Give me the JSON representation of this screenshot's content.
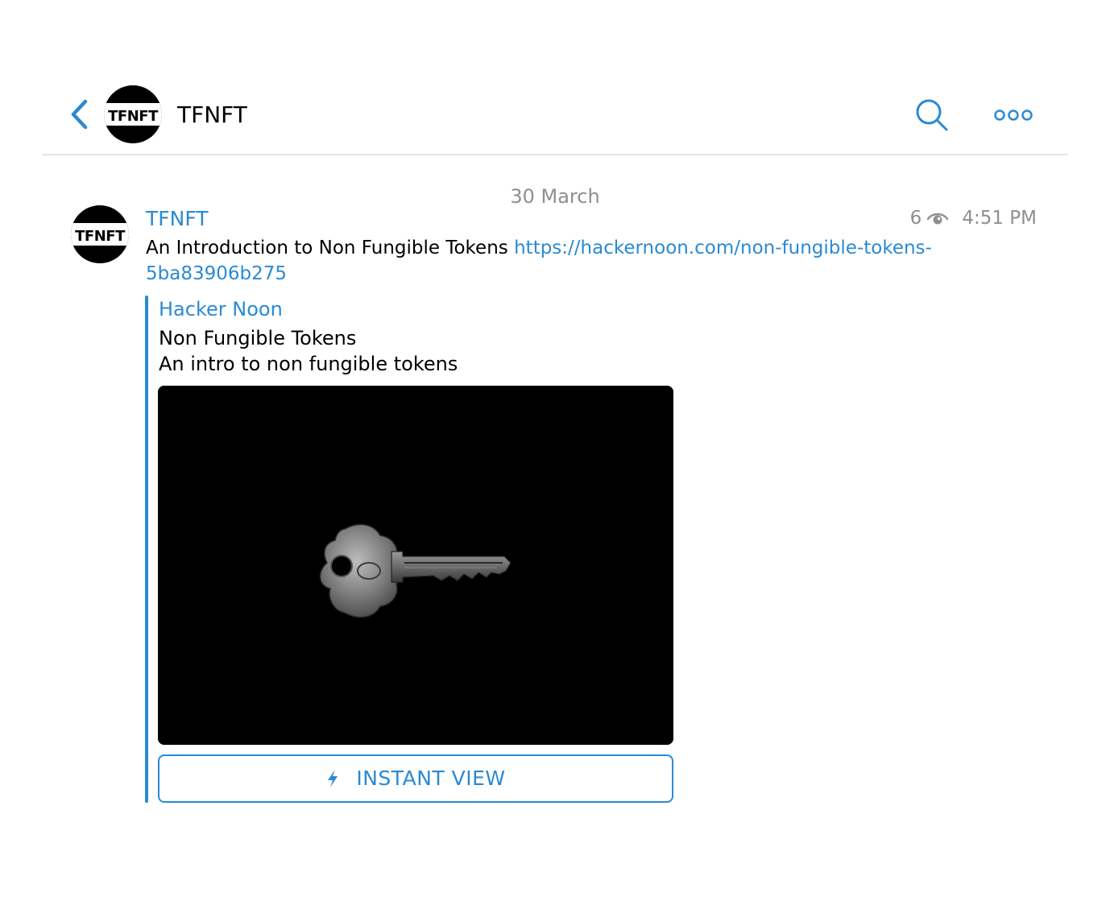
{
  "header": {
    "title": "TFNFT",
    "avatar_logo_text": "TFNFT",
    "back_icon": "chevron-left-icon",
    "search_icon": "search-icon",
    "more_icon": "more-dots-icon"
  },
  "date_separator": "30 March",
  "message": {
    "sender": "TFNFT",
    "avatar_logo_text": "TFNFT",
    "views": "6",
    "views_icon": "eye-icon",
    "time": "4:51 PM",
    "text": "An Introduction to Non Fungible Tokens",
    "link": "https://hackernoon.com/non-fungible-tokens-5ba83906b275",
    "preview": {
      "site_name": "Hacker Noon",
      "title": "Non Fungible Tokens",
      "description": "An intro to non fungible tokens",
      "image_icon": "key-photo",
      "instant_view_icon": "lightning-icon",
      "instant_view_label": "INSTANT VIEW"
    }
  },
  "colors": {
    "accent": "#2a8ad4",
    "muted": "#8e8e93",
    "divider": "#e6e6e6",
    "background": "#ffffff"
  }
}
